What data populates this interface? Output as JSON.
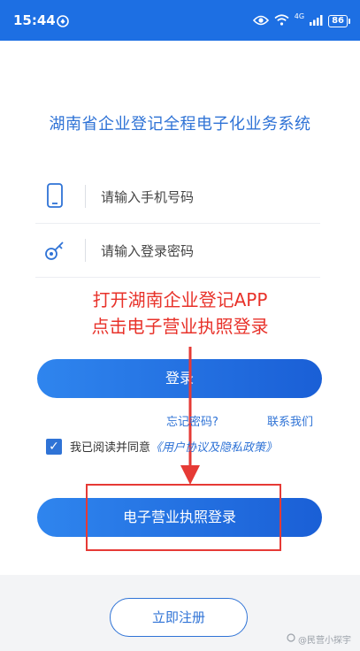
{
  "status_bar": {
    "time": "15:44",
    "network": "4G",
    "battery": "86"
  },
  "page": {
    "title": "湖南省企业登记全程电子化业务系统"
  },
  "form": {
    "phone_placeholder": "请输入手机号码",
    "password_placeholder": "请输入登录密码"
  },
  "annotation": {
    "line1": "打开湖南企业登记APP",
    "line2": "点击电子营业执照登录"
  },
  "actions": {
    "login_label": "登录",
    "forgot_password": "忘记密码?",
    "contact_us": "联系我们",
    "license_login_label": "电子营业执照登录",
    "register_label": "立即注册"
  },
  "agreement": {
    "checked": true,
    "text": "我已阅读并同意",
    "link": "《用户协议及隐私政策》"
  },
  "watermark": {
    "text": "@民营小探宇"
  },
  "colors": {
    "brand_blue": "#2f73d6",
    "annotation_red": "#e8322a"
  }
}
